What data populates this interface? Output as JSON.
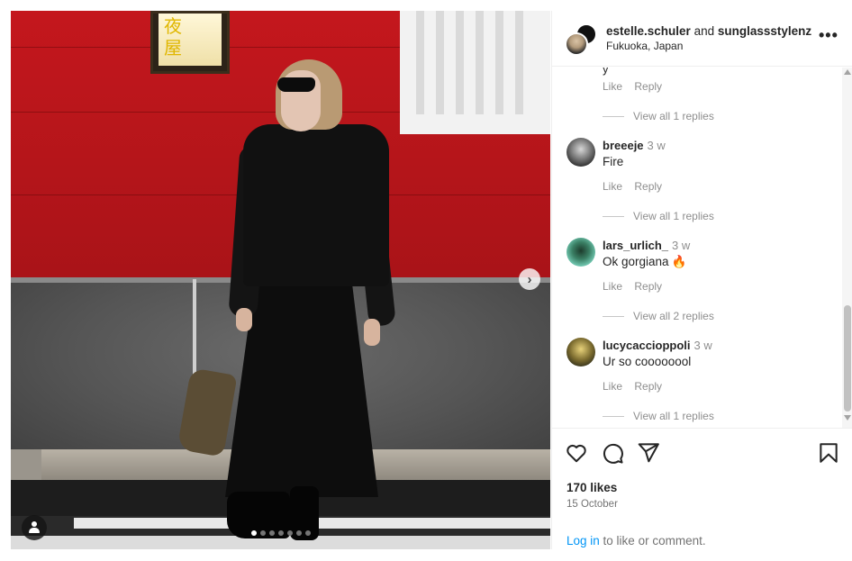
{
  "post": {
    "author": "estelle.schuler",
    "joiner": "and",
    "coauthor": "sunglassstylenz",
    "location": "Fukuoka, Japan",
    "more_label": "•••",
    "carousel": {
      "total_slides": 7,
      "active_index": 0
    }
  },
  "comments": {
    "partial_text": "y",
    "like_label": "Like",
    "reply_label": "Reply",
    "first_thread_replies": "View all 1 replies",
    "items": [
      {
        "username": "breeeje",
        "time": "3 w",
        "text": "Fire",
        "replies": "View all 1 replies"
      },
      {
        "username": "lars_urlich_",
        "time": "3 w",
        "text": "Ok gorgiana",
        "emoji": "🔥",
        "replies": "View all 2 replies"
      },
      {
        "username": "lucycaccioppoli",
        "time": "3 w",
        "text": "Ur so coooooool",
        "replies": "View all 1 replies"
      }
    ]
  },
  "stats": {
    "likes": "170 likes",
    "date": "15 October"
  },
  "footer": {
    "login_link": "Log in",
    "login_rest": " to like or comment."
  },
  "sign_text": "夜\n屋",
  "icons": [
    "heart-icon",
    "comment-icon",
    "share-icon",
    "bookmark-icon",
    "chevron-right-icon",
    "user-tag-icon"
  ],
  "colors": {
    "link": "#0095f6",
    "secondary_text": "#8e8e8e",
    "primary_text": "#262626"
  }
}
